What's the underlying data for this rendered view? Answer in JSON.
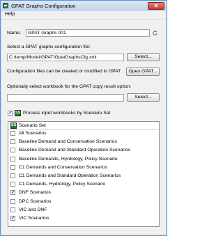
{
  "window": {
    "title": "GPAT Graphs Configuration",
    "close_glyph": "✕"
  },
  "menu": {
    "help": "Help"
  },
  "name": {
    "label": "Name:",
    "value": "GPAT Graphs 001"
  },
  "config_file": {
    "label": "Select a GPAT graphs configuration file:",
    "value": "C:/temp/Model/GPAT/GpatGraphsCfg.xml",
    "select_button": "Select...",
    "note": "Configuration files can be created or modified in GPAT",
    "open_button": "Open GPAT..."
  },
  "workbook": {
    "label": "Optionally select workbook for the GPAT copy result option:",
    "value": "",
    "select_button": "Select..."
  },
  "process": {
    "label": "Process input workbooks by Scenario Set",
    "checked": true,
    "icon_text": "SS"
  },
  "scenario_set": {
    "header": "Scenario Set",
    "items": [
      {
        "label": "All Scenarios",
        "checked": false
      },
      {
        "label": "Baseline Demand and Conservation Scenarios",
        "checked": false
      },
      {
        "label": "Baseline Demand and Standard Operation Scenarios",
        "checked": false
      },
      {
        "label": "Baseline Demands, Hyrdology, Policy Scenario",
        "checked": false
      },
      {
        "label": "C1 Demands and Conservation Scenarios",
        "checked": false
      },
      {
        "label": "C1 Demands and Standard Operation Scenarios",
        "checked": false
      },
      {
        "label": "C1 Demands, Hydrology, Policy Scenario",
        "checked": false
      },
      {
        "label": "DNF Scenarios",
        "checked": true
      },
      {
        "label": "DPC Scenarios",
        "checked": false
      },
      {
        "label": "VIC and DNF",
        "checked": false
      },
      {
        "label": "VIC Scenarios",
        "checked": true
      }
    ]
  },
  "icons": {
    "app": "app-icon",
    "refresh": "refresh-icon",
    "scenario_set": "scenario-set-icon"
  }
}
